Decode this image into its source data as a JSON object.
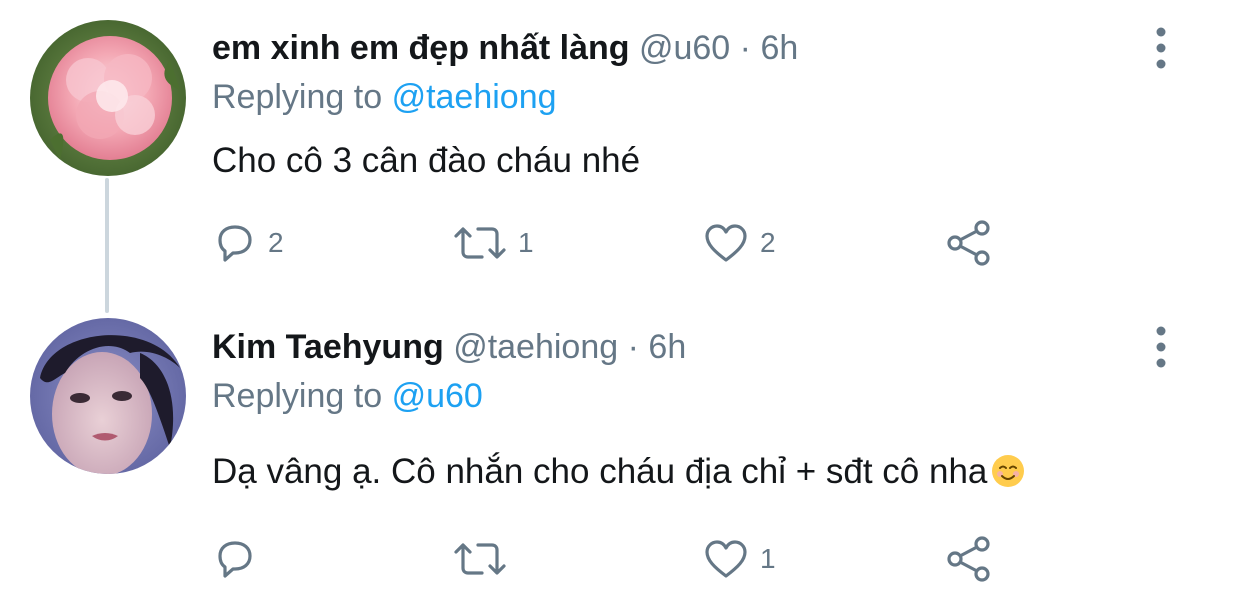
{
  "tweets": [
    {
      "display_name": "em xinh em đẹp nhất làng",
      "handle": "@u60",
      "separator": "·",
      "time": "6h",
      "replying_prefix": "Replying to",
      "replying_to": "@taehiong",
      "text": "Cho cô 3 cân đào cháu nhé",
      "avatar_icon": "pink-peony-avatar",
      "reply_count": "2",
      "retweet_count": "1",
      "like_count": "2",
      "share_count": ""
    },
    {
      "display_name": "Kim Taehyung",
      "handle": "@taehiong",
      "separator": "·",
      "time": "6h",
      "replying_prefix": "Replying to",
      "replying_to": "@u60",
      "text": "Dạ vâng ạ. Cô nhắn cho cháu địa chỉ + sđt cô nha",
      "emoji_icon": "smiling-face-emoji",
      "avatar_icon": "portrait-avatar",
      "reply_count": "",
      "retweet_count": "",
      "like_count": "1",
      "share_count": ""
    }
  ],
  "colors": {
    "text_primary": "#14171a",
    "text_secondary": "#657786",
    "link": "#1da1f2",
    "thread_line": "#ccd6dd"
  }
}
